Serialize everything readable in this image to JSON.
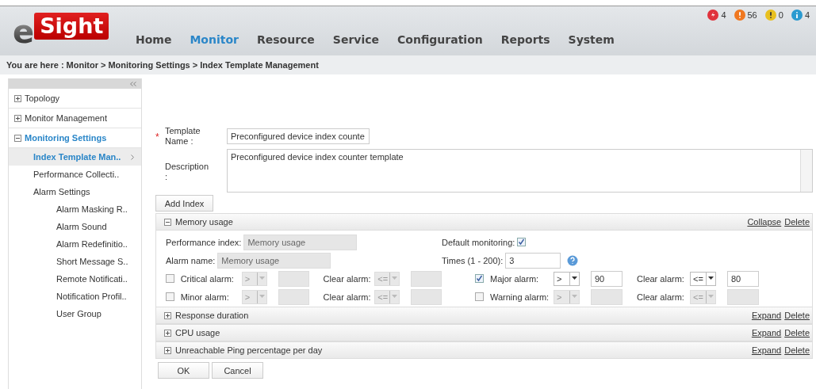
{
  "logo": {
    "letter": "e",
    "word": "Sight"
  },
  "nav": [
    {
      "label": "Home",
      "selected": false
    },
    {
      "label": "Monitor",
      "selected": true
    },
    {
      "label": "Resource",
      "selected": false
    },
    {
      "label": "Service",
      "selected": false
    },
    {
      "label": "Configuration",
      "selected": false
    },
    {
      "label": "Reports",
      "selected": false
    },
    {
      "label": "System",
      "selected": false
    }
  ],
  "alarm_counts": [
    {
      "kind": "critical",
      "count": "4",
      "color": "#e0323c"
    },
    {
      "kind": "major",
      "count": "56",
      "color": "#f07820"
    },
    {
      "kind": "minor",
      "count": "0",
      "color": "#e8c020"
    },
    {
      "kind": "info",
      "count": "4",
      "color": "#2a9ad0"
    }
  ],
  "breadcrumb": "You are here : Monitor > Monitoring Settings > Index Template Management",
  "sidebar": {
    "items": [
      {
        "label": "Topology",
        "expanded": false
      },
      {
        "label": "Monitor Management",
        "expanded": false
      },
      {
        "label": "Monitoring Settings",
        "expanded": true,
        "children": [
          {
            "label": "Index Template Man..",
            "selected": true
          },
          {
            "label": "Performance Collecti..",
            "selected": false
          },
          {
            "label": "Alarm Settings",
            "selected": false,
            "children": [
              {
                "label": "Alarm Masking R..",
                "selected": false
              },
              {
                "label": "Alarm Sound",
                "selected": false
              },
              {
                "label": "Alarm Redefinitio..",
                "selected": false
              },
              {
                "label": "Short Message S..",
                "selected": false
              },
              {
                "label": "Remote Notificati..",
                "selected": false
              },
              {
                "label": "Notification Profil..",
                "selected": false
              },
              {
                "label": "User Group",
                "selected": false
              }
            ]
          }
        ]
      }
    ]
  },
  "form": {
    "template_name": {
      "label": "Template Name :",
      "value": "Preconfigured device index counte",
      "required_mark": "*"
    },
    "description": {
      "label": "Description :",
      "value": "Preconfigured device index counter template"
    },
    "add_button": "Add Index"
  },
  "sections": [
    {
      "title": "Memory usage",
      "expanded": true,
      "toggle": "Collapse",
      "delete": "Delete",
      "performance_index": {
        "label": "Performance index:",
        "value": "Memory usage"
      },
      "alarm_name": {
        "label": "Alarm name:",
        "value": "Memory usage"
      },
      "default_monitoring": {
        "label": "Default monitoring:",
        "checked": true
      },
      "times": {
        "label": "Times (1 - 200):",
        "value": "3"
      },
      "alarms": [
        {
          "label": "Critical alarm:",
          "checked": false,
          "operator": ">",
          "clear_label": "Clear alarm:",
          "clear_operator": "<="
        },
        {
          "label": "Major alarm:",
          "checked": true,
          "operator": ">",
          "value": "90",
          "clear_label": "Clear alarm:",
          "clear_operator": "<=",
          "clear_value": "80"
        },
        {
          "label": "Minor alarm:",
          "checked": false,
          "operator": ">",
          "clear_label": "Clear alarm:",
          "clear_operator": "<="
        },
        {
          "label": "Warning alarm:",
          "checked": false,
          "operator": ">",
          "clear_label": "Clear alarm:",
          "clear_operator": "<="
        }
      ]
    },
    {
      "title": "Response duration",
      "expanded": false,
      "toggle": "Expand",
      "delete": "Delete"
    },
    {
      "title": "CPU usage",
      "expanded": false,
      "toggle": "Expand",
      "delete": "Delete"
    },
    {
      "title": "Unreachable Ping percentage per day",
      "expanded": false,
      "toggle": "Expand",
      "delete": "Delete"
    }
  ],
  "buttons": [
    "OK",
    "Cancel"
  ]
}
